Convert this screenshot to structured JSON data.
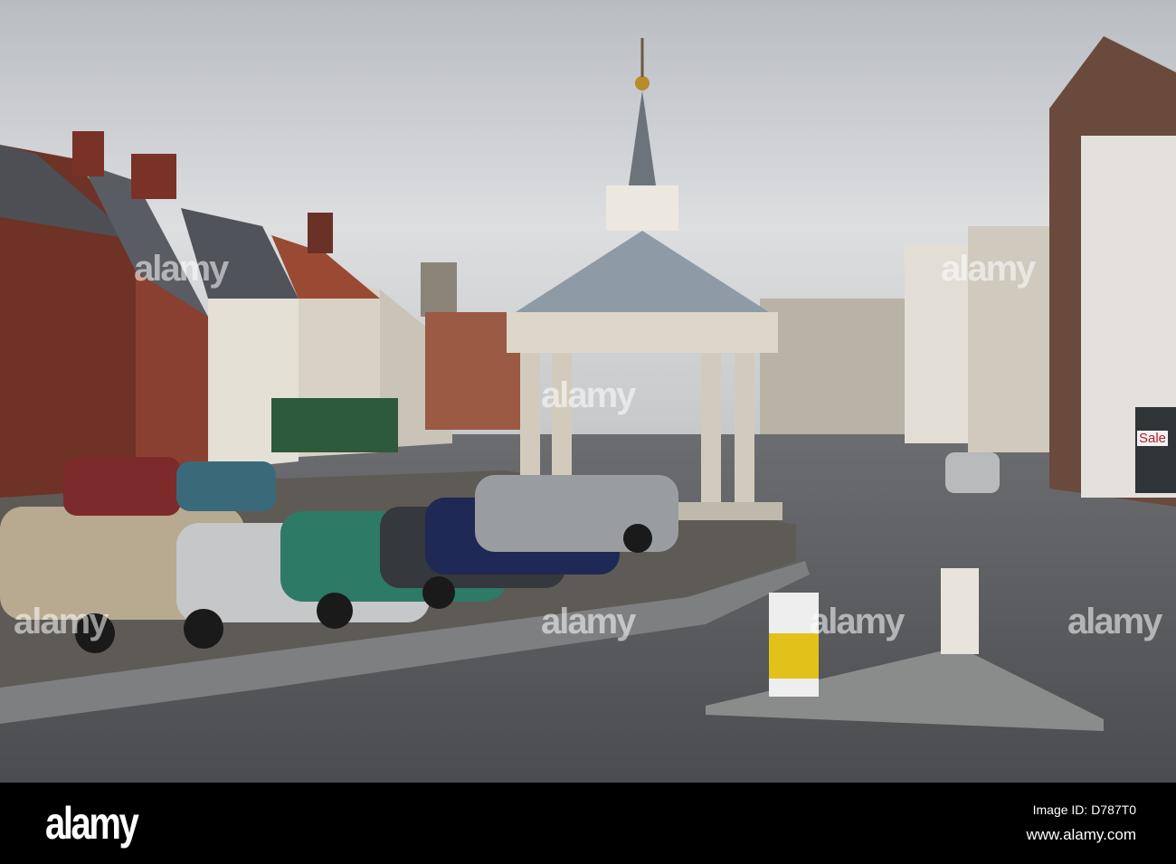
{
  "photo": {
    "subject": "market-square-with-buttercross",
    "shop_sign_sale": "Sale",
    "colors": {
      "sky": "#c9ccd0",
      "brick": "#7a3a2c",
      "road": "#55585b",
      "stone": "#d6d1c4",
      "roof": "#8e9aa6"
    }
  },
  "watermark": {
    "text": "alamy"
  },
  "footer": {
    "logo": "alamy",
    "image_id": "Image ID: D787T0",
    "url": "www.alamy.com"
  }
}
